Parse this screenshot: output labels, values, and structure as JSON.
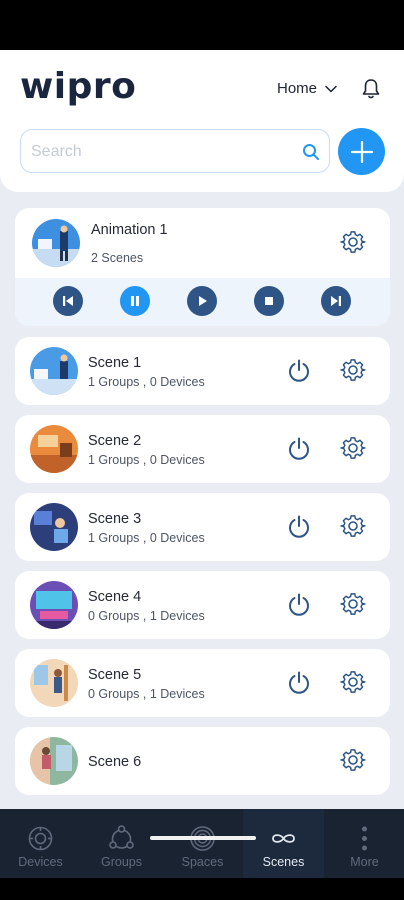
{
  "header": {
    "logo": "wipro",
    "home_label": "Home",
    "search_placeholder": "Search"
  },
  "animation": {
    "title": "Animation 1",
    "subtitle": "2 Scenes"
  },
  "scenes": [
    {
      "title": "Scene 1",
      "subtitle": "1 Groups , 0 Devices",
      "has_power": true
    },
    {
      "title": "Scene 2",
      "subtitle": "1 Groups , 0 Devices",
      "has_power": true
    },
    {
      "title": "Scene 3",
      "subtitle": "1 Groups , 0 Devices",
      "has_power": true
    },
    {
      "title": "Scene 4",
      "subtitle": "0 Groups , 1 Devices",
      "has_power": true
    },
    {
      "title": "Scene 5",
      "subtitle": "0 Groups , 1 Devices",
      "has_power": true
    },
    {
      "title": "Scene 6",
      "subtitle": "",
      "has_power": false
    }
  ],
  "tabs": [
    {
      "label": "Devices",
      "icon": "gear-badge-icon",
      "active": false
    },
    {
      "label": "Groups",
      "icon": "groups-icon",
      "active": false
    },
    {
      "label": "Spaces",
      "icon": "spaces-icon",
      "active": false
    },
    {
      "label": "Scenes",
      "icon": "infinity-icon",
      "active": true
    },
    {
      "label": "More",
      "icon": "more-vertical-icon",
      "active": false
    }
  ],
  "colors": {
    "accent": "#2196f3",
    "control": "#2e5585",
    "tabbar": "#1a2332",
    "icon": "#2e5585"
  }
}
